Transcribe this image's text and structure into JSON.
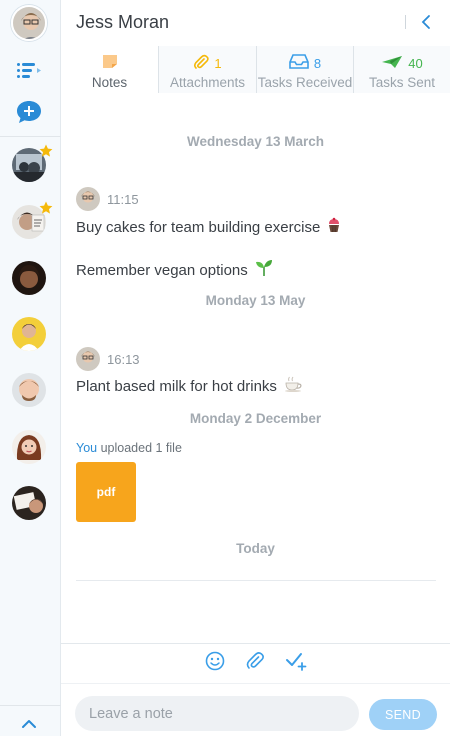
{
  "contact": {
    "name": "Jess Moran"
  },
  "colors": {
    "accent": "#2a8bd6",
    "rail": "#f5f9fc",
    "file": "#f7a51c",
    "send": "#9fd1f7",
    "star": "#f5b90a"
  },
  "rail": {
    "icons": [
      "current-user-avatar",
      "menu-list-icon",
      "new-chat-icon",
      "scroll-up-icon"
    ],
    "contacts": [
      {
        "name": "contact-1",
        "starred": true
      },
      {
        "name": "contact-2",
        "starred": true
      },
      {
        "name": "contact-3",
        "starred": false
      },
      {
        "name": "contact-4",
        "starred": false
      },
      {
        "name": "contact-5",
        "starred": false
      },
      {
        "name": "contact-6",
        "starred": false
      },
      {
        "name": "contact-7",
        "starred": false
      }
    ]
  },
  "tabs": [
    {
      "label": "Notes",
      "count": "",
      "icon": "note-icon",
      "color": "#f7a51c",
      "active": true
    },
    {
      "label": "Attachments",
      "count": "1",
      "icon": "paperclip-icon",
      "color": "#f5b90a",
      "active": false
    },
    {
      "label": "Tasks Received",
      "count": "8",
      "icon": "inbox-tray-icon",
      "color": "#3a9ee8",
      "active": false
    },
    {
      "label": "Tasks Sent",
      "count": "40",
      "icon": "paper-plane-icon",
      "color": "#45b54f",
      "active": false
    }
  ],
  "feed": {
    "dates": [
      "Wednesday 13 March",
      "Monday 13 May",
      "Monday 2 December",
      "Today"
    ],
    "entries": [
      {
        "time": "11:15",
        "notes": [
          {
            "text": "Buy cakes for team building exercise",
            "emoji": "cupcake"
          },
          {
            "text": "Remember vegan options",
            "emoji": "seedling"
          }
        ]
      },
      {
        "time": "16:13",
        "notes": [
          {
            "text": "Plant based milk for hot drinks",
            "emoji": "hot-drink"
          }
        ]
      }
    ],
    "upload": {
      "you": "You",
      "text": "uploaded 1 file",
      "file_label": "pdf"
    }
  },
  "composer": {
    "placeholder": "Leave a note",
    "send_label": "SEND"
  }
}
